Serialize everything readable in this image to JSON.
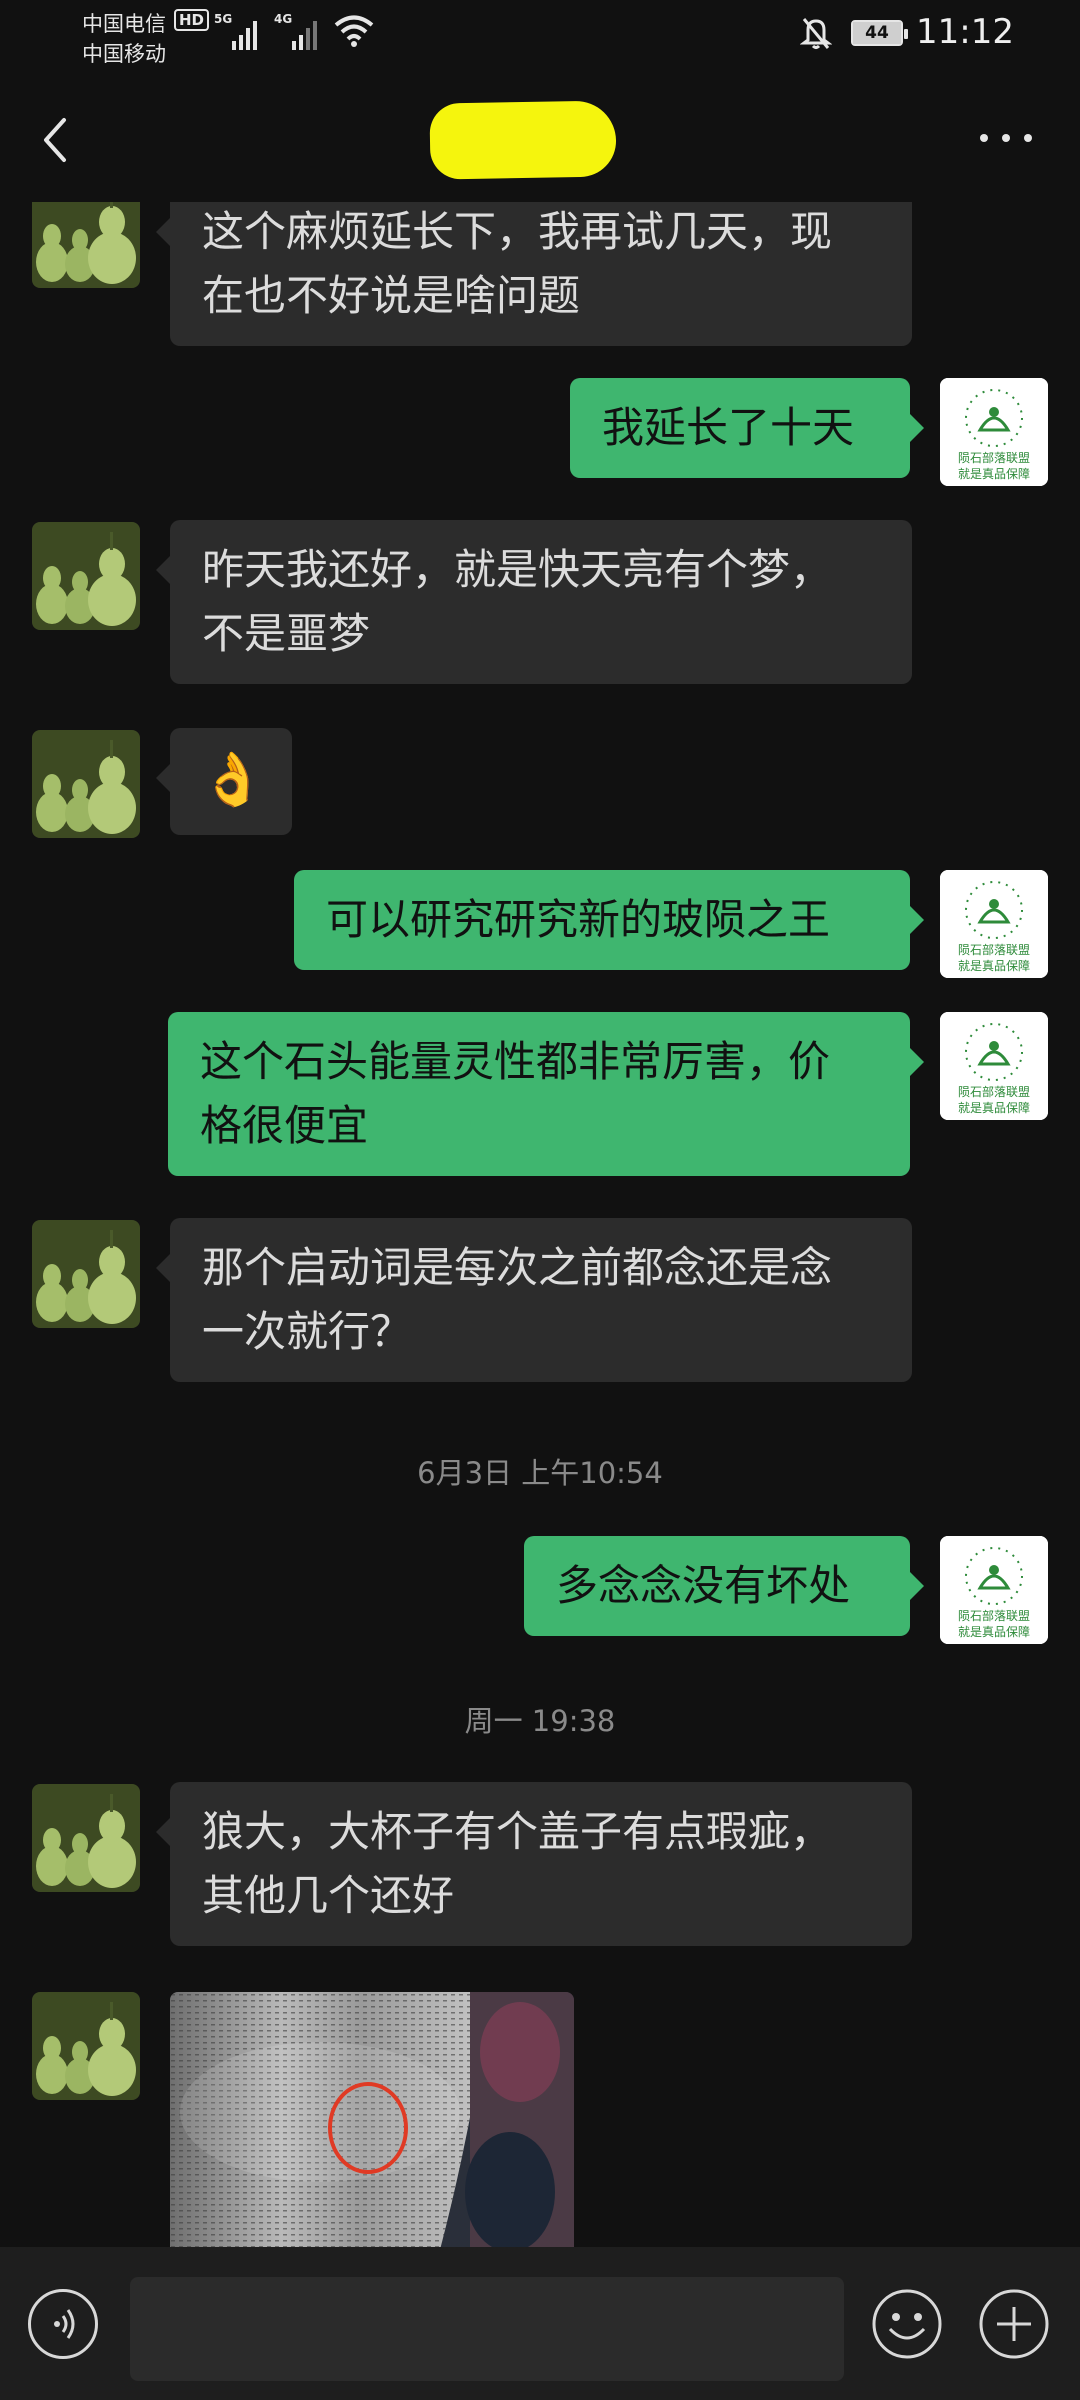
{
  "status_bar": {
    "carrier_1": "中国电信",
    "carrier_1_badge": "HD",
    "signal_1_label": "5G",
    "carrier_2": "中国移动",
    "signal_2_label": "4G",
    "battery": "44",
    "time": "11:12"
  },
  "header": {
    "back_icon": "chevron-left-icon",
    "contact_name_redacted": true,
    "more_icon": "more-horizontal-icon"
  },
  "colors": {
    "background": "#111111",
    "sent_bubble": "#3fb66f",
    "received_bubble": "#2c2c2c",
    "redaction": "#f5f50d"
  },
  "messages": [
    {
      "side": "left",
      "text_lines": [
        "这个麻烦延长下，我再试几天，现",
        "在也不好说是啥问题"
      ]
    },
    {
      "side": "right",
      "text_lines": [
        "我延长了十天"
      ]
    },
    {
      "side": "left",
      "text_lines": [
        "昨天我还好，就是快天亮有个梦，",
        "不是噩梦"
      ]
    },
    {
      "side": "left",
      "emoji": "👌"
    },
    {
      "side": "right",
      "text_lines": [
        "可以研究研究新的玻陨之王"
      ]
    },
    {
      "side": "right",
      "text_lines": [
        "这个石头能量灵性都非常厉害，价",
        "格很便宜"
      ]
    },
    {
      "side": "left",
      "text_lines": [
        "那个启动词是每次之前都念还是念",
        "一次就行？"
      ]
    },
    {
      "timestamp": "6月3日 上午10:54"
    },
    {
      "side": "right",
      "text_lines": [
        "多念念没有坏处"
      ]
    },
    {
      "timestamp": "周一 19:38"
    },
    {
      "side": "left",
      "text_lines": [
        "狼大，大杯子有个盖子有点瑕疵，",
        "其他几个还好"
      ]
    },
    {
      "side": "left",
      "image": "photo of engraved crystal bowl with red circle marking a flaw"
    }
  ],
  "avatar_right_text": [
    "陨石部落联盟",
    "就是真品保障"
  ],
  "input_bar": {
    "voice_icon": "voice-input-icon",
    "text_value": "",
    "emoji_icon": "emoji-face-icon",
    "plus_icon": "plus-icon"
  }
}
